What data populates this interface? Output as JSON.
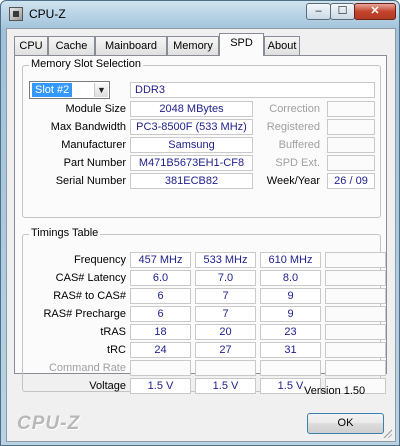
{
  "window": {
    "title": "CPU-Z",
    "min_glyph": "–",
    "max_glyph": "☐",
    "close_glyph": "✕"
  },
  "tabs": [
    "CPU",
    "Cache",
    "Mainboard",
    "Memory",
    "SPD",
    "About"
  ],
  "active_tab": "SPD",
  "slot": {
    "legend": "Memory Slot Selection",
    "selected": "Slot #2",
    "type": "DDR3",
    "rows": [
      {
        "label": "Module Size",
        "value": "2048 MBytes",
        "rlabel": "Correction",
        "rvalue": ""
      },
      {
        "label": "Max Bandwidth",
        "value": "PC3-8500F (533 MHz)",
        "rlabel": "Registered",
        "rvalue": ""
      },
      {
        "label": "Manufacturer",
        "value": "Samsung",
        "rlabel": "Buffered",
        "rvalue": ""
      },
      {
        "label": "Part Number",
        "value": "M471B5673EH1-CF8",
        "rlabel": "SPD Ext.",
        "rvalue": ""
      },
      {
        "label": "Serial Number",
        "value": "381ECB82",
        "rlabel": "Week/Year",
        "rvalue": "26 / 09"
      }
    ]
  },
  "timings": {
    "legend": "Timings Table",
    "rows": [
      {
        "label": "Frequency",
        "values": [
          "457 MHz",
          "533 MHz",
          "610 MHz",
          ""
        ]
      },
      {
        "label": "CAS# Latency",
        "values": [
          "6.0",
          "7.0",
          "8.0",
          ""
        ]
      },
      {
        "label": "RAS# to CAS#",
        "values": [
          "6",
          "7",
          "9",
          ""
        ]
      },
      {
        "label": "RAS# Precharge",
        "values": [
          "6",
          "7",
          "9",
          ""
        ]
      },
      {
        "label": "tRAS",
        "values": [
          "18",
          "20",
          "23",
          ""
        ]
      },
      {
        "label": "tRC",
        "values": [
          "24",
          "27",
          "31",
          ""
        ]
      },
      {
        "label": "Command Rate",
        "values": [
          "",
          "",
          "",
          ""
        ]
      },
      {
        "label": "Voltage",
        "values": [
          "1.5 V",
          "1.5 V",
          "1.5 V",
          ""
        ]
      }
    ]
  },
  "footer": {
    "version": "Version 1.50",
    "brand": "CPU-Z",
    "ok_label": "OK"
  }
}
